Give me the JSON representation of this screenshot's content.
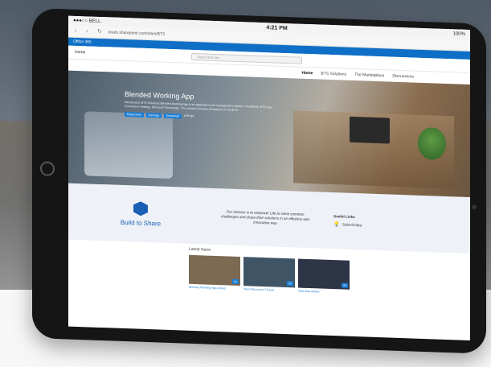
{
  "status_bar": {
    "carrier": "●●●○○ BELL",
    "time": "4:21 PM",
    "battery": "100%"
  },
  "browser": {
    "url": "leeds.sharepoint.com/sites/BTS"
  },
  "suite_bar": {
    "app_name": "Office 365"
  },
  "header": {
    "home_label": "Home",
    "search_placeholder": "Search this site"
  },
  "top_nav": [
    "Home",
    "BTS Solutions",
    "The Marketplace",
    "Discussions"
  ],
  "hero": {
    "title": "Blended Working App",
    "description": "Introduction: BTS Solutions Blended Working App is an application and management solution. Handbook, BTS App, Connection Settings, Microsoft PowerApps. The solution includes all aspects of The BTS.",
    "buttons": [
      "Read more",
      "Get App",
      "Download"
    ],
    "link": "Let's go"
  },
  "brand": {
    "logo_text": "Build to Share"
  },
  "mission": "Our mission is to empower Life to solve common challenges and share their solutions in an effective and innovative way",
  "useful_links": {
    "title": "Useful Links",
    "items": [
      "Submit Idea"
    ]
  },
  "latest_news": {
    "title": "Latest News",
    "cards": [
      {
        "title": "Blended Working App Added",
        "badge": "1/6",
        "color": "#7c6a53"
      },
      {
        "title": "New Discussion Thread",
        "badge": "2/6",
        "color": "#3f5566"
      },
      {
        "title": "New Idea Added",
        "badge": "3/6",
        "color": "#2d3546"
      }
    ]
  }
}
